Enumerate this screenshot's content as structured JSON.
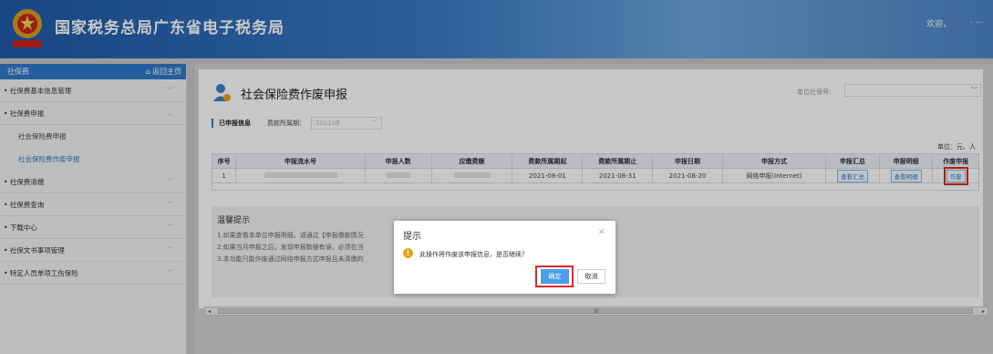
{
  "header": {
    "title": "国家税务总局广东省电子税务局",
    "welcome": "欢迎，",
    "welcome_suffix": ". ...",
    "emblem_text": "税务"
  },
  "sidebar": {
    "head_title": "社保费",
    "home_label": "返回主页",
    "items": [
      {
        "label": "社保费基本信息管理"
      },
      {
        "label": "社保费申报"
      },
      {
        "label": "社会保险费申报"
      },
      {
        "label": "社会保险费作废申报"
      },
      {
        "label": "社保费清缴"
      },
      {
        "label": "社保费查询"
      },
      {
        "label": "下载中心"
      },
      {
        "label": "社保文书事项管理"
      },
      {
        "label": "特定人员单项工伤保险"
      }
    ]
  },
  "main": {
    "page_title": "社会保险费作废申报",
    "unit_label": "单位社保号:",
    "info_label": "已申报信息",
    "period_label": "费款所属期：",
    "period_value": "202108",
    "unit_note": "单位：元、人",
    "table": {
      "headers": [
        "序号",
        "申报流水号",
        "申报人数",
        "应缴费额",
        "费款所属期起",
        "费款所属期止",
        "申报日期",
        "申报方式",
        "申报汇总",
        "申报明细",
        "作废申报"
      ],
      "rows": [
        {
          "no": "1",
          "start": "2021-08-01",
          "end": "2021-08-31",
          "date": "2021-08-20",
          "method": "网络申报(Internet)",
          "summary_btn": "查看汇总",
          "detail_btn": "查看明细",
          "void_btn": "作废"
        }
      ]
    },
    "tips": {
      "title": "温馨提示",
      "lines": [
        "1.如果查看本单位申报明细，请通过【申报缴款情况",
        "2.如果当月申报之后，发现申报数据有误，必须在当",
        "3.本功能只能作废通过网络申报方式申报且未清缴的"
      ]
    },
    "scroll_mark": "III"
  },
  "dialog": {
    "title": "提示",
    "message": "此操作将作废该申报信息，是否继续？",
    "ok_label": "确定",
    "cancel_label": "取消",
    "icon": "!"
  }
}
